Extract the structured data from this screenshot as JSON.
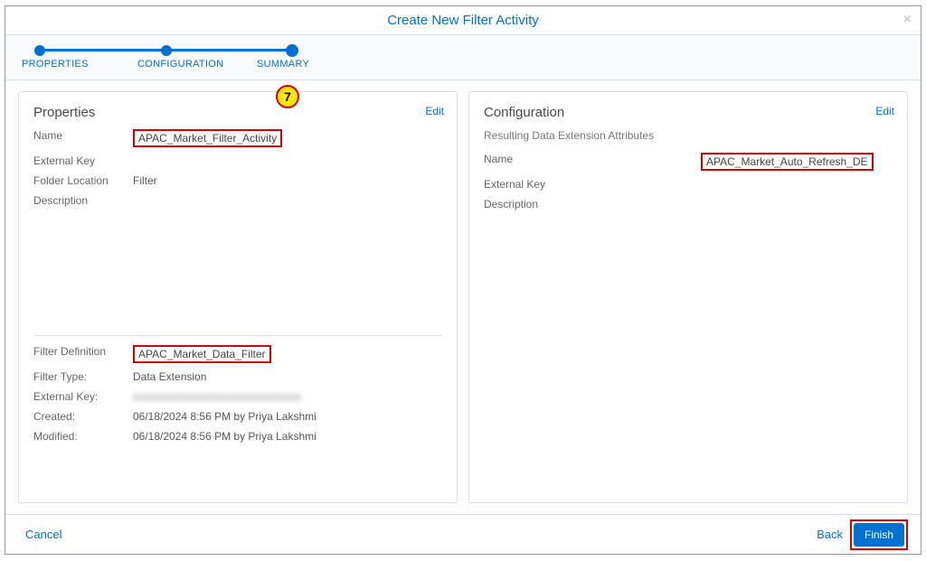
{
  "modal": {
    "title": "Create New Filter Activity",
    "close": "×"
  },
  "stepper": {
    "s1": "PROPERTIES",
    "s2": "CONFIGURATION",
    "s3": "SUMMARY"
  },
  "badge": "7",
  "properties": {
    "title": "Properties",
    "edit": "Edit",
    "name_label": "Name",
    "name_value": "APAC_Market_Filter_Activity",
    "extkey_label": "External Key",
    "extkey_value": "",
    "folder_label": "Folder Location",
    "folder_value": "Filter",
    "desc_label": "Description",
    "desc_value": "",
    "filterdef_label": "Filter Definition",
    "filterdef_value": "APAC_Market_Data_Filter",
    "filtertype_label": "Filter Type:",
    "filtertype_value": "Data Extension",
    "extkey2_label": "External Key:",
    "extkey2_value": "xxxxxxxxxxxxxxxxxxxxxxxxxxxxxxx",
    "created_label": "Created:",
    "created_value": "06/18/2024 8:56 PM by Priya Lakshmi",
    "modified_label": "Modified:",
    "modified_value": "06/18/2024 8:56 PM by Priya Lakshmi"
  },
  "configuration": {
    "title": "Configuration",
    "edit": "Edit",
    "subheading": "Resulting Data Extension Attributes",
    "name_label": "Name",
    "name_value": "APAC_Market_Auto_Refresh_DE",
    "extkey_label": "External Key",
    "extkey_value": "",
    "desc_label": "Description",
    "desc_value": ""
  },
  "footer": {
    "cancel": "Cancel",
    "back": "Back",
    "finish": "Finish"
  }
}
